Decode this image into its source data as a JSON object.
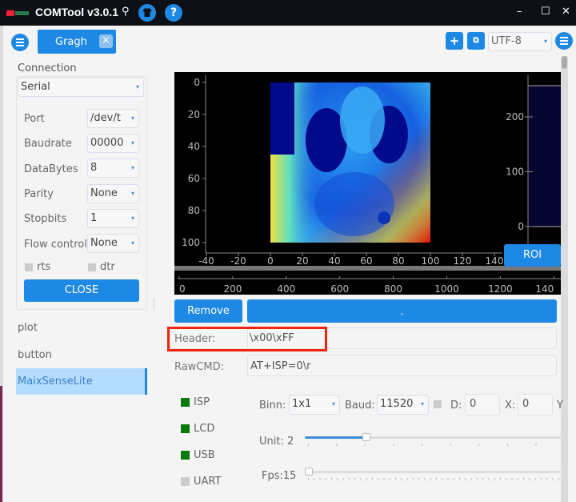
{
  "titlebar": {
    "title": "COMTool v3.0.1",
    "pin_icon": "pin-icon",
    "skin_icon": "tshirt-icon",
    "help_icon": "?",
    "minimize": "–",
    "maximize": "☐",
    "close": "✕"
  },
  "toolbar": {
    "tab_label": "Gragh",
    "tab_close": "×",
    "add_label": "+",
    "encoding": "UTF-8"
  },
  "connection": {
    "title": "Connection",
    "type": "Serial",
    "fields": [
      {
        "label": "Port",
        "value": "/dev/t"
      },
      {
        "label": "Baudrate",
        "value": "00000"
      },
      {
        "label": "DataBytes",
        "value": "8"
      },
      {
        "label": "Parity",
        "value": "None"
      },
      {
        "label": "Stopbits",
        "value": "1"
      },
      {
        "label": "Flow control",
        "value": "None"
      }
    ],
    "rts_label": "rts",
    "dtr_label": "dtr",
    "close_button": "CLOSE"
  },
  "nav": {
    "items": [
      "plot",
      "button",
      "MaixSenseLite"
    ],
    "active": "MaixSenseLite"
  },
  "plot": {
    "image_axis": {
      "x_ticks": [
        "-40",
        "-20",
        "0",
        "20",
        "40",
        "60",
        "80",
        "100",
        "120",
        "140"
      ],
      "y_ticks": [
        "0",
        "20",
        "40",
        "60",
        "80",
        "100"
      ]
    },
    "histogram_axis": {
      "y_ticks": [
        "200",
        "100",
        "0"
      ]
    },
    "bottom_axis": {
      "x_ticks": [
        "0",
        "200",
        "400",
        "600",
        "800",
        "1000",
        "1200",
        "140"
      ]
    },
    "roi_button": "ROI"
  },
  "actions": {
    "remove_button": "Remove",
    "wide_button": "."
  },
  "fields": {
    "header_label": "Header:",
    "header_value": "\\x00\\xFF",
    "rawcmd_label": "RawCMD:",
    "rawcmd_value": "AT+ISP=0\\r"
  },
  "status": [
    {
      "label": "ISP",
      "on": true
    },
    {
      "label": "LCD",
      "on": true
    },
    {
      "label": "USB",
      "on": true
    },
    {
      "label": "UART",
      "on": false
    }
  ],
  "colors": {
    "accent": "#1e88e5",
    "led_on": "#0a7a0a",
    "led_off": "#cccccc",
    "highlight": "#f0250f"
  },
  "controls": {
    "binn_label": "Binn:",
    "binn_value": "1x1",
    "baud_label": "Baud:",
    "baud_value": "11520",
    "d_label": "D:",
    "d_value": "0",
    "x_label": "X:",
    "x_value": "0",
    "y_label": "Y",
    "unit_label": "Unit: 2",
    "unit_fraction": 0.24,
    "fps_label": "Fps:15",
    "fps_fraction": 0.0
  }
}
